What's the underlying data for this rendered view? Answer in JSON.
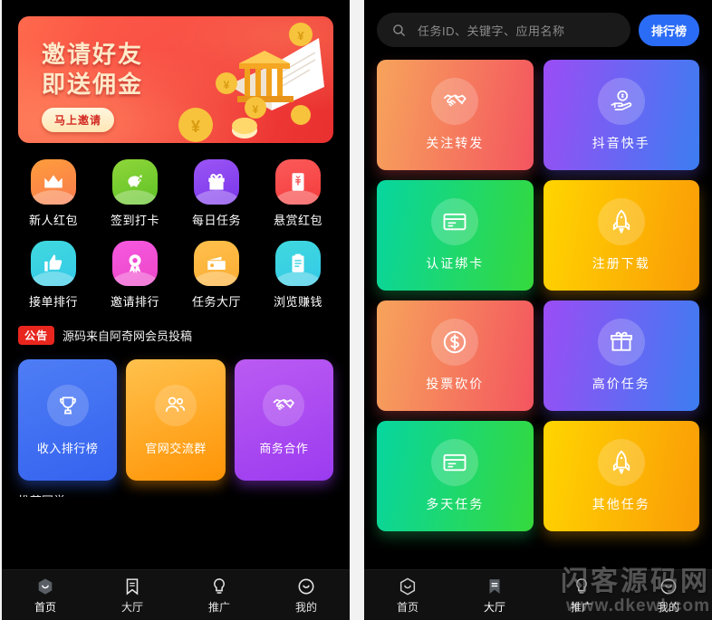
{
  "colors": {
    "page_background": "#f2f2f2",
    "phone_background": "#000000",
    "accent_blue": "#2b6cf6",
    "notice_red": "#e8261e",
    "banner_red": "#f8453f",
    "banner_text": "#ffe9c9"
  },
  "left_phone": {
    "banner": {
      "line1": "邀请好友",
      "line2": "即送佣金",
      "button_label": "马上邀请"
    },
    "icon_grid": [
      {
        "label": "新人红包",
        "icon": "crown-icon",
        "color_start": "#ff9d3c",
        "color_end": "#f87a4e"
      },
      {
        "label": "签到打卡",
        "icon": "piggy-bank-icon",
        "color_start": "#8fd63a",
        "color_end": "#5fc226"
      },
      {
        "label": "每日任务",
        "icon": "gift-icon",
        "color_start": "#9b55f5",
        "color_end": "#7a36ea"
      },
      {
        "label": "悬赏红包",
        "icon": "red-envelope-icon",
        "color_start": "#fc5b5b",
        "color_end": "#f43b3b"
      },
      {
        "label": "接单排行",
        "icon": "thumbs-up-icon",
        "color_start": "#3fd9de",
        "color_end": "#35c9e8"
      },
      {
        "label": "邀请排行",
        "icon": "medal-icon",
        "color_start": "#f659e0",
        "color_end": "#ec46c8"
      },
      {
        "label": "任务大厅",
        "icon": "wallet-icon",
        "color_start": "#ffc04d",
        "color_end": "#fbad33"
      },
      {
        "label": "浏览赚钱",
        "icon": "clipboard-icon",
        "color_start": "#3fd9de",
        "color_end": "#35c9e8"
      }
    ],
    "notice": {
      "badge": "公告",
      "text": "源码来自阿奇网会员投稿"
    },
    "feature_cards": [
      {
        "label": "收入排行榜",
        "icon": "trophy-icon",
        "theme": "c-blue"
      },
      {
        "label": "官网交流群",
        "icon": "group-icon",
        "theme": "c-orange"
      },
      {
        "label": "商务合作",
        "icon": "handshake-icon",
        "theme": "c-purple"
      }
    ],
    "cut_off_text": "推荐同学",
    "tabbar": [
      {
        "label": "首页",
        "icon": "home-hexagon-icon",
        "active": true
      },
      {
        "label": "大厅",
        "icon": "bookmark-icon",
        "active": false
      },
      {
        "label": "推广",
        "icon": "lightbulb-icon",
        "active": false
      },
      {
        "label": "我的",
        "icon": "user-circle-icon",
        "active": false
      }
    ]
  },
  "right_phone": {
    "search": {
      "placeholder": "任务ID、关键字、应用名称",
      "value": "",
      "icon": "search-icon",
      "rank_button": "排行榜"
    },
    "task_cards": [
      {
        "label": "关注转发",
        "icon": "handshake-icon",
        "theme": "t-sunset"
      },
      {
        "label": "抖音快手",
        "icon": "hand-money-icon",
        "theme": "t-violet"
      },
      {
        "label": "认证绑卡",
        "icon": "card-icon",
        "theme": "t-green"
      },
      {
        "label": "注册下载",
        "icon": "rocket-icon",
        "theme": "t-gold"
      },
      {
        "label": "投票砍价",
        "icon": "dollar-circle-icon",
        "theme": "t-sunset"
      },
      {
        "label": "高价任务",
        "icon": "gift-icon",
        "theme": "t-violet"
      },
      {
        "label": "多天任务",
        "icon": "card-icon",
        "theme": "t-green"
      },
      {
        "label": "其他任务",
        "icon": "rocket-icon",
        "theme": "t-gold"
      }
    ],
    "tabbar": [
      {
        "label": "首页",
        "icon": "home-hexagon-icon",
        "active": false
      },
      {
        "label": "大厅",
        "icon": "bookmark-icon",
        "active": true
      },
      {
        "label": "推广",
        "icon": "lightbulb-icon",
        "active": false
      },
      {
        "label": "我的",
        "icon": "user-circle-icon",
        "active": false
      }
    ],
    "watermark": {
      "line1": "闪客源码网",
      "line2": "www.dkewl.com"
    }
  }
}
